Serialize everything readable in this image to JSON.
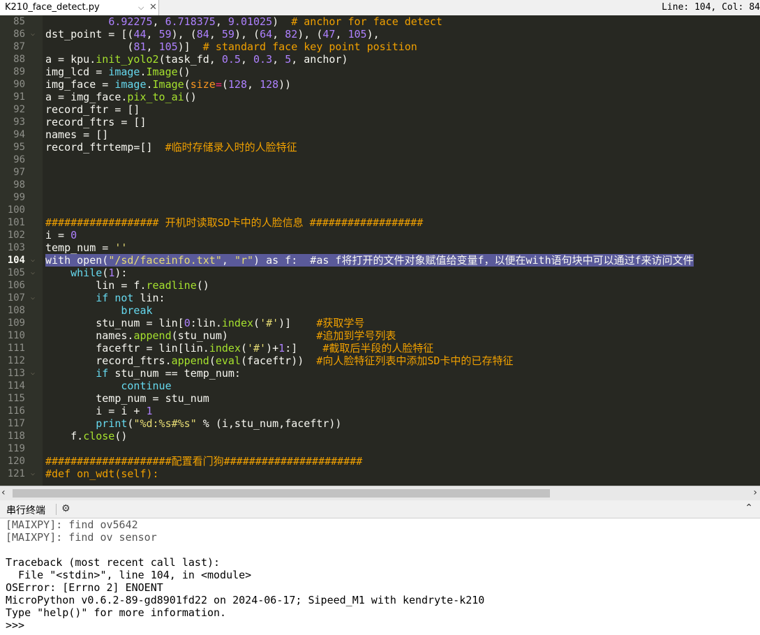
{
  "tab": {
    "filename": "K210_face_detect.py",
    "dropdown_icon": "chevron-down",
    "close_icon": "close"
  },
  "status": {
    "text": "Line: 104, Col: 84"
  },
  "editor": {
    "current_line": "104",
    "lines": [
      {
        "num": "85",
        "fold": false,
        "tokens": [
          [
            "plain",
            "          "
          ],
          [
            "num",
            "6.92275"
          ],
          [
            "plain",
            ", "
          ],
          [
            "num",
            "6.718375"
          ],
          [
            "plain",
            ", "
          ],
          [
            "num",
            "9.01025"
          ],
          [
            "plain",
            ")  "
          ],
          [
            "cmt",
            "# anchor for face detect"
          ]
        ]
      },
      {
        "num": "86",
        "fold": true,
        "tokens": [
          [
            "plain",
            "dst_point = [("
          ],
          [
            "num",
            "44"
          ],
          [
            "plain",
            ", "
          ],
          [
            "num",
            "59"
          ],
          [
            "plain",
            "), ("
          ],
          [
            "num",
            "84"
          ],
          [
            "plain",
            ", "
          ],
          [
            "num",
            "59"
          ],
          [
            "plain",
            "), ("
          ],
          [
            "num",
            "64"
          ],
          [
            "plain",
            ", "
          ],
          [
            "num",
            "82"
          ],
          [
            "plain",
            "), ("
          ],
          [
            "num",
            "47"
          ],
          [
            "plain",
            ", "
          ],
          [
            "num",
            "105"
          ],
          [
            "plain",
            "),"
          ]
        ]
      },
      {
        "num": "87",
        "fold": false,
        "tokens": [
          [
            "plain",
            "             ("
          ],
          [
            "num",
            "81"
          ],
          [
            "plain",
            ", "
          ],
          [
            "num",
            "105"
          ],
          [
            "plain",
            ")]  "
          ],
          [
            "cmt",
            "# standard face key point position"
          ]
        ]
      },
      {
        "num": "88",
        "fold": false,
        "tokens": [
          [
            "plain",
            "a = kpu."
          ],
          [
            "fn",
            "init_yolo2"
          ],
          [
            "plain",
            "(task_fd, "
          ],
          [
            "num",
            "0.5"
          ],
          [
            "plain",
            ", "
          ],
          [
            "num",
            "0.3"
          ],
          [
            "plain",
            ", "
          ],
          [
            "num",
            "5"
          ],
          [
            "plain",
            ", anchor)"
          ]
        ]
      },
      {
        "num": "89",
        "fold": false,
        "tokens": [
          [
            "plain",
            "img_lcd = "
          ],
          [
            "kw",
            "image"
          ],
          [
            "plain",
            "."
          ],
          [
            "fn",
            "Image"
          ],
          [
            "plain",
            "()"
          ]
        ]
      },
      {
        "num": "90",
        "fold": false,
        "tokens": [
          [
            "plain",
            "img_face = "
          ],
          [
            "kw",
            "image"
          ],
          [
            "plain",
            "."
          ],
          [
            "fn",
            "Image"
          ],
          [
            "plain",
            "("
          ],
          [
            "param",
            "size"
          ],
          [
            "op",
            "="
          ],
          [
            "plain",
            "("
          ],
          [
            "num",
            "128"
          ],
          [
            "plain",
            ", "
          ],
          [
            "num",
            "128"
          ],
          [
            "plain",
            "))"
          ]
        ]
      },
      {
        "num": "91",
        "fold": false,
        "tokens": [
          [
            "plain",
            "a = img_face."
          ],
          [
            "fn",
            "pix_to_ai"
          ],
          [
            "plain",
            "()"
          ]
        ]
      },
      {
        "num": "92",
        "fold": false,
        "tokens": [
          [
            "plain",
            "record_ftr = []"
          ]
        ]
      },
      {
        "num": "93",
        "fold": false,
        "tokens": [
          [
            "plain",
            "record_ftrs = []"
          ]
        ]
      },
      {
        "num": "94",
        "fold": false,
        "tokens": [
          [
            "plain",
            "names = []"
          ]
        ]
      },
      {
        "num": "95",
        "fold": false,
        "tokens": [
          [
            "plain",
            "record_ftrtemp=[]  "
          ],
          [
            "cmt",
            "#临时存储录入时的人脸特征"
          ]
        ]
      },
      {
        "num": "96",
        "fold": false,
        "tokens": []
      },
      {
        "num": "97",
        "fold": false,
        "tokens": []
      },
      {
        "num": "98",
        "fold": false,
        "tokens": []
      },
      {
        "num": "99",
        "fold": false,
        "tokens": []
      },
      {
        "num": "100",
        "fold": false,
        "tokens": []
      },
      {
        "num": "101",
        "fold": false,
        "tokens": [
          [
            "cmt",
            "################## 开机时读取SD卡中的人脸信息 ##################"
          ]
        ]
      },
      {
        "num": "102",
        "fold": false,
        "tokens": [
          [
            "plain",
            "i = "
          ],
          [
            "num",
            "0"
          ]
        ]
      },
      {
        "num": "103",
        "fold": false,
        "tokens": [
          [
            "plain",
            "temp_num = "
          ],
          [
            "str",
            "''"
          ]
        ]
      },
      {
        "num": "104",
        "fold": true,
        "tokens": [
          [
            "plain",
            "with open("
          ],
          [
            "str",
            "\"/sd/faceinfo.txt\""
          ],
          [
            "plain",
            ", "
          ],
          [
            "str",
            "\"r\""
          ],
          [
            "plain",
            ") as f:  #as f将打开的文件对象赋值给变量f，以便在with语句块中可以通过f来访问文件"
          ]
        ]
      },
      {
        "num": "105",
        "fold": true,
        "tokens": [
          [
            "plain",
            "    "
          ],
          [
            "kw",
            "while"
          ],
          [
            "plain",
            "("
          ],
          [
            "num",
            "1"
          ],
          [
            "plain",
            "):"
          ]
        ]
      },
      {
        "num": "106",
        "fold": false,
        "tokens": [
          [
            "plain",
            "        lin = f."
          ],
          [
            "fn",
            "readline"
          ],
          [
            "plain",
            "()"
          ]
        ]
      },
      {
        "num": "107",
        "fold": true,
        "tokens": [
          [
            "plain",
            "        "
          ],
          [
            "kw",
            "if not"
          ],
          [
            "plain",
            " lin:"
          ]
        ]
      },
      {
        "num": "108",
        "fold": false,
        "tokens": [
          [
            "plain",
            "            "
          ],
          [
            "kw",
            "break"
          ]
        ]
      },
      {
        "num": "109",
        "fold": false,
        "tokens": [
          [
            "plain",
            "        stu_num = lin["
          ],
          [
            "num",
            "0"
          ],
          [
            "plain",
            ":lin."
          ],
          [
            "fn",
            "index"
          ],
          [
            "plain",
            "("
          ],
          [
            "str",
            "'#'"
          ],
          [
            "plain",
            ")]    "
          ],
          [
            "cmt",
            "#获取学号"
          ]
        ]
      },
      {
        "num": "110",
        "fold": false,
        "tokens": [
          [
            "plain",
            "        names."
          ],
          [
            "fn",
            "append"
          ],
          [
            "plain",
            "(stu_num)              "
          ],
          [
            "cmt",
            "#追加到学号列表"
          ]
        ]
      },
      {
        "num": "111",
        "fold": false,
        "tokens": [
          [
            "plain",
            "        faceftr = lin[lin."
          ],
          [
            "fn",
            "index"
          ],
          [
            "plain",
            "("
          ],
          [
            "str",
            "'#'"
          ],
          [
            "plain",
            ")+"
          ],
          [
            "num",
            "1"
          ],
          [
            "plain",
            ":]    "
          ],
          [
            "cmt",
            "#截取后半段的人脸特征"
          ]
        ]
      },
      {
        "num": "112",
        "fold": false,
        "tokens": [
          [
            "plain",
            "        record_ftrs."
          ],
          [
            "fn",
            "append"
          ],
          [
            "plain",
            "("
          ],
          [
            "fn",
            "eval"
          ],
          [
            "plain",
            "(faceftr))  "
          ],
          [
            "cmt",
            "#向人脸特征列表中添加SD卡中的已存特征"
          ]
        ]
      },
      {
        "num": "113",
        "fold": true,
        "tokens": [
          [
            "plain",
            "        "
          ],
          [
            "kw",
            "if"
          ],
          [
            "plain",
            " stu_num == temp_num:"
          ]
        ]
      },
      {
        "num": "114",
        "fold": false,
        "tokens": [
          [
            "plain",
            "            "
          ],
          [
            "kw",
            "continue"
          ]
        ]
      },
      {
        "num": "115",
        "fold": false,
        "tokens": [
          [
            "plain",
            "        temp_num = stu_num"
          ]
        ]
      },
      {
        "num": "116",
        "fold": false,
        "tokens": [
          [
            "plain",
            "        i = i + "
          ],
          [
            "num",
            "1"
          ]
        ]
      },
      {
        "num": "117",
        "fold": false,
        "tokens": [
          [
            "plain",
            "        "
          ],
          [
            "kw",
            "print"
          ],
          [
            "plain",
            "("
          ],
          [
            "str",
            "\"%d:%s#%s\""
          ],
          [
            "plain",
            " % (i,stu_num,faceftr))"
          ]
        ]
      },
      {
        "num": "118",
        "fold": false,
        "tokens": [
          [
            "plain",
            "    f."
          ],
          [
            "fn",
            "close"
          ],
          [
            "plain",
            "()"
          ]
        ]
      },
      {
        "num": "119",
        "fold": false,
        "tokens": []
      },
      {
        "num": "120",
        "fold": false,
        "tokens": [
          [
            "cmt",
            "####################配置看门狗######################"
          ]
        ]
      },
      {
        "num": "121",
        "fold": true,
        "tokens": [
          [
            "cmt",
            "#def on_wdt(self):"
          ]
        ]
      }
    ]
  },
  "terminal": {
    "title": "串行终端",
    "tool_icon": "settings-icon",
    "collapse_icon": "chevron-up",
    "lines": [
      {
        "text": "[MAIXPY]: find ov5642",
        "dim": true
      },
      {
        "text": "[MAIXPY]: find ov sensor",
        "dim": true
      },
      {
        "text": "",
        "dim": false
      },
      {
        "text": "Traceback (most recent call last):",
        "dim": false
      },
      {
        "text": "  File \"<stdin>\", line 104, in <module>",
        "dim": false
      },
      {
        "text": "OSError: [Errno 2] ENOENT",
        "dim": false
      },
      {
        "text": "MicroPython v0.6.2-89-gd8901fd22 on 2024-06-17; Sipeed_M1 with kendryte-k210",
        "dim": false
      },
      {
        "text": "Type \"help()\" for more information.",
        "dim": false
      },
      {
        "text": ">>> ",
        "dim": false
      }
    ]
  },
  "colors": {
    "editor_bg": "#272822",
    "current_line": "#5a5a9a",
    "comment": "#f0a000",
    "keyword": "#66d9ef",
    "function": "#a6e22e",
    "number": "#ae81ff",
    "string": "#e6db74"
  }
}
